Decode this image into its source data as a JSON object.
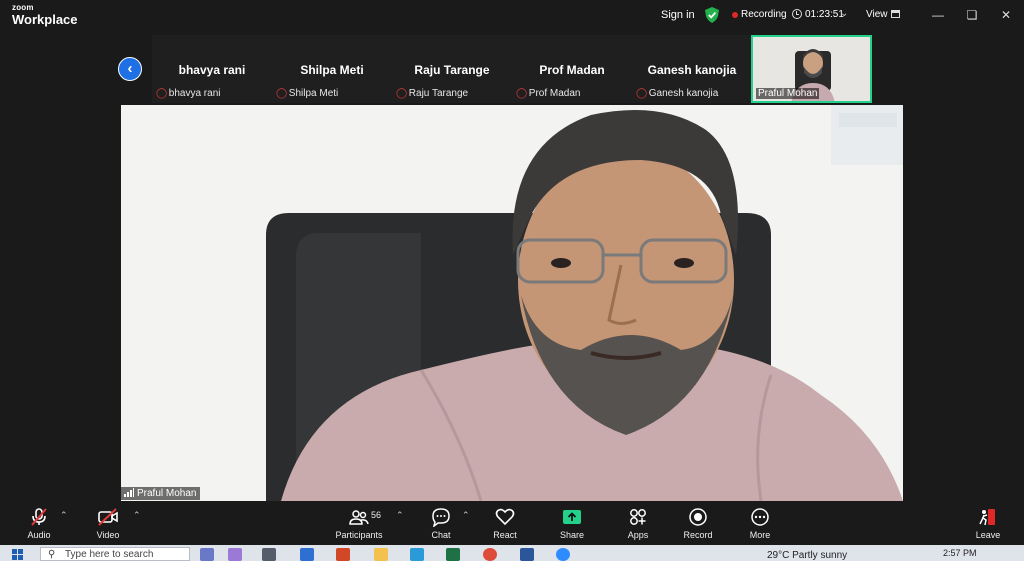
{
  "app": {
    "logo_line1": "zoom",
    "logo_line2": "Workplace"
  },
  "header": {
    "sign_in": "Sign in",
    "recording_label": "Recording",
    "timer": "01:23:51",
    "view_label": "View"
  },
  "participants": [
    {
      "name": "bhavya rani",
      "label": "bhavya rani"
    },
    {
      "name": "Shilpa Meti",
      "label": "Shilpa Meti"
    },
    {
      "name": "Raju Tarange",
      "label": "Raju Tarange"
    },
    {
      "name": "Prof Madan",
      "label": "Prof Madan"
    },
    {
      "name": "Ganesh kanojia",
      "label": "Ganesh kanojia"
    }
  ],
  "self_tile": {
    "name": "Praful Mohan"
  },
  "main_video": {
    "speaker_name": "Praful Mohan"
  },
  "toolbar": {
    "audio": "Audio",
    "video": "Video",
    "participants": "Participants",
    "participant_count": "56",
    "chat": "Chat",
    "react": "React",
    "share": "Share",
    "apps": "Apps",
    "record": "Record",
    "more": "More",
    "leave": "Leave"
  },
  "taskbar": {
    "search_placeholder": "Type here to search",
    "weather": "29°C  Partly sunny",
    "time": "2:57 PM"
  },
  "colors": {
    "active_speaker_border": "#23d18b",
    "recording_dot": "#e02828",
    "back_button": "#1f6fe5",
    "share_green": "#23d18b",
    "muted_red": "#e03a3a"
  }
}
